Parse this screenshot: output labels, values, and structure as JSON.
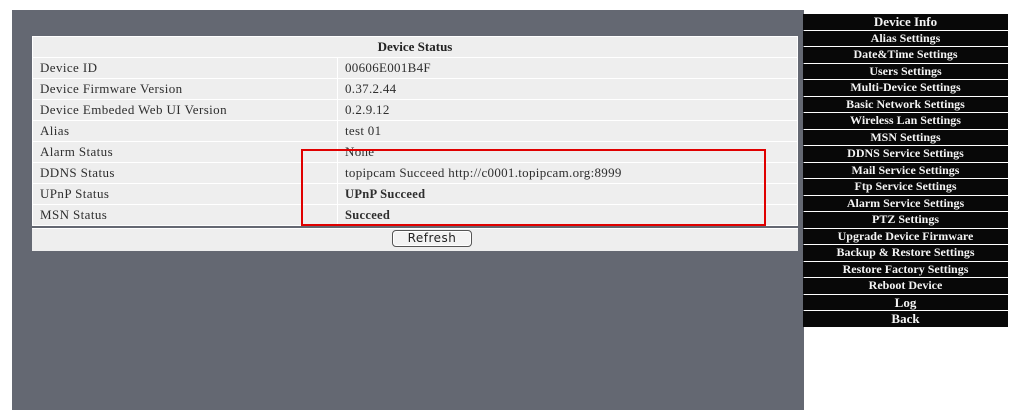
{
  "status_table": {
    "title": "Device Status",
    "rows": [
      {
        "label": "Device ID",
        "value": "00606E001B4F"
      },
      {
        "label": "Device Firmware Version",
        "value": "0.37.2.44"
      },
      {
        "label": "Device Embeded Web UI Version",
        "value": "0.2.9.12"
      },
      {
        "label": "Alias",
        "value": "test 01"
      },
      {
        "label": "Alarm Status",
        "value": "None"
      },
      {
        "label": "DDNS Status",
        "value": "topipcam Succeed  http://c0001.topipcam.org:8999"
      },
      {
        "label": "UPnP Status",
        "value": "UPnP Succeed"
      },
      {
        "label": "MSN Status",
        "value": "Succeed"
      }
    ],
    "refresh_label": "Refresh"
  },
  "menu": {
    "items": [
      "Device Info",
      "Alias Settings",
      "Date&Time Settings",
      "Users Settings",
      "Multi-Device Settings",
      "Basic Network Settings",
      "Wireless Lan Settings",
      "MSN Settings",
      "DDNS Service Settings",
      "Mail Service Settings",
      "Ftp Service Settings",
      "Alarm Service Settings",
      "PTZ Settings",
      "Upgrade Device Firmware",
      "Backup & Restore Settings",
      "Restore Factory Settings",
      "Reboot Device",
      "Log",
      "Back"
    ]
  },
  "colors": {
    "panel_background": "#646872",
    "table_background": "#eeeeee",
    "menu_background": "#080808",
    "highlight_border": "#e00000"
  }
}
